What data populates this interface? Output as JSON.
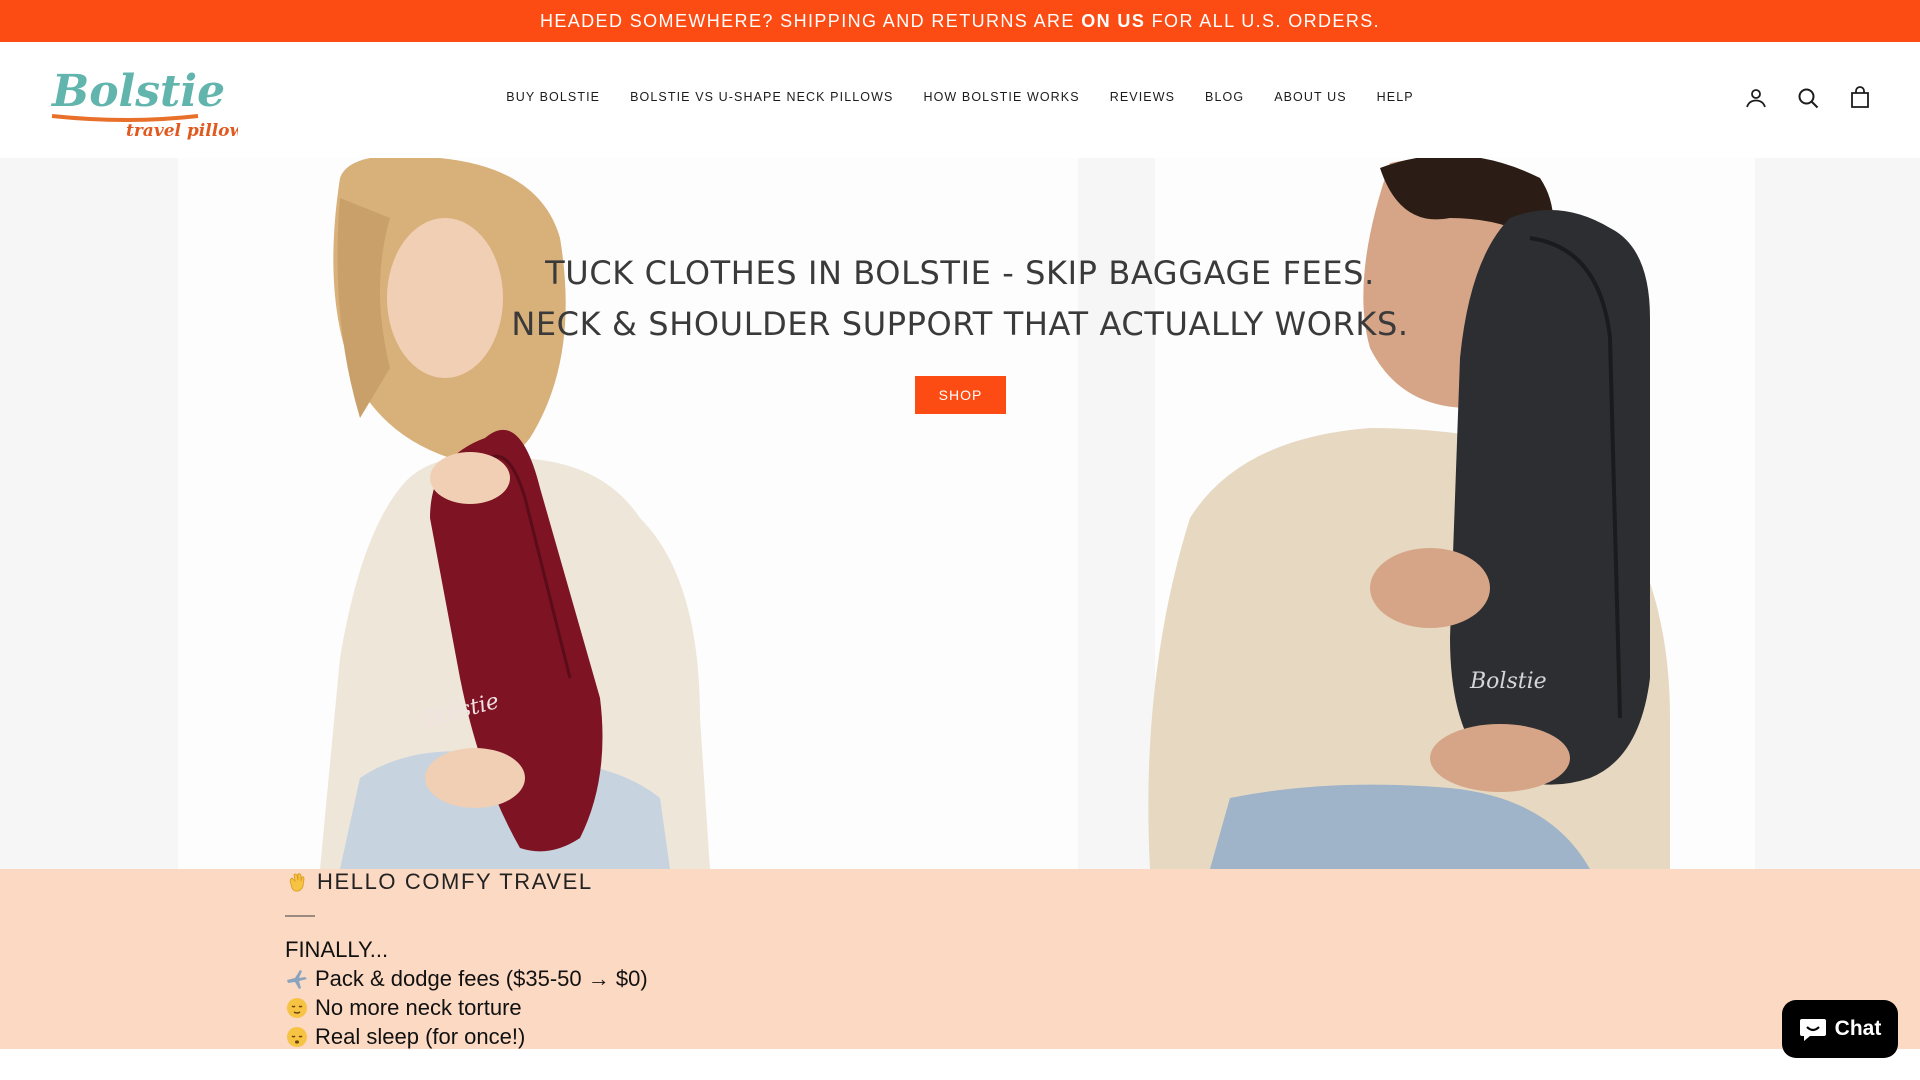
{
  "announcement": {
    "prefix": "HEADED SOMEWHERE? SHIPPING AND RETURNS ARE ",
    "bold": "ON US",
    "suffix": " FOR ALL U.S. ORDERS."
  },
  "brand": {
    "name": "Bolstie",
    "tagline": "travel pillow",
    "colors": {
      "accent": "#fc4c14",
      "logo_teal": "#5fb3b0",
      "logo_orange": "#e8702a"
    }
  },
  "nav": {
    "items": [
      "BUY BOLSTIE",
      "BOLSTIE VS U-SHAPE NECK PILLOWS",
      "HOW BOLSTIE WORKS",
      "REVIEWS",
      "BLOG",
      "ABOUT US",
      "HELP"
    ]
  },
  "header_icons": [
    "account-icon",
    "search-icon",
    "cart-icon"
  ],
  "hero": {
    "line1": "TUCK CLOTHES IN BOLSTIE - SKIP BAGGAGE FEES.",
    "line2": "NECK & SHOULDER SUPPORT THAT ACTUALLY WORKS.",
    "button": "SHOP",
    "pillow_text": "Bolstie"
  },
  "intro": {
    "heading": "HELLO COMFY TRAVEL",
    "heading_icon": "waving-hand-icon",
    "lines": [
      {
        "icon": "",
        "text": "FINALLY..."
      },
      {
        "icon": "airplane-icon",
        "text": "Pack & dodge fees ($35-50 → $0)"
      },
      {
        "icon": "relieved-face-icon",
        "text": "No more neck torture"
      },
      {
        "icon": "sleeping-face-icon",
        "text": "Real sleep (for once!)"
      }
    ]
  },
  "chat": {
    "label": "Chat"
  }
}
